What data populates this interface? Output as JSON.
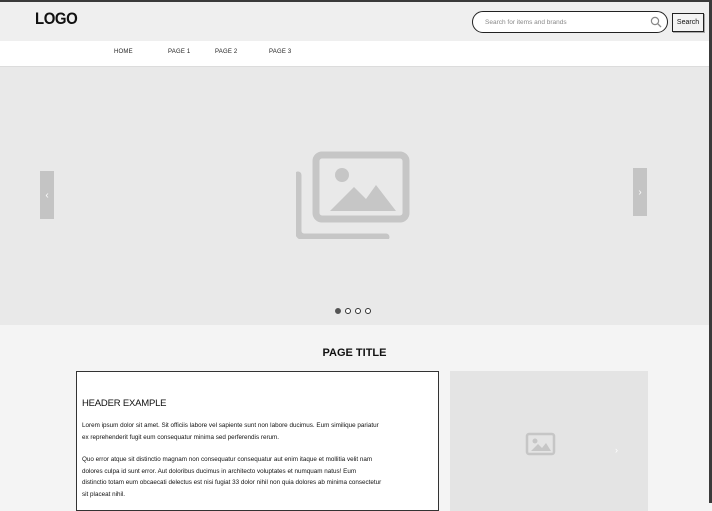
{
  "header": {
    "logo": "LOGO",
    "search_placeholder": "Search for items and brands",
    "search_button": "Search"
  },
  "nav": {
    "items": [
      "HOME",
      "PAGE 1",
      "PAGE 2",
      "PAGE 3"
    ]
  },
  "carousel": {
    "prev_arrow": "‹",
    "next_arrow": "›",
    "slide_count": 4,
    "active_slide": 1
  },
  "content": {
    "page_title": "PAGE TITLE",
    "card": {
      "header": "HEADER EXAMPLE",
      "paragraph1": "Lorem ipsum dolor sit amet. Sit officiis labore vel sapiente sunt non labore ducimus. Eum similique pariatur ex reprehenderit fugit eum consequatur minima sed perferendis rerum.",
      "paragraph2": "Quo error atque sit distinctio magnam non consequatur consequatur aut enim itaque et mollitia velit nam dolores culpa id sunt error. Aut doloribus ducimus in architecto voluptates et numquam natus! Eum distinctio totam eum obcaecati delectus est nisi fugiat 33 dolor nihil non quia dolores ab minima consectetur sit placeat nihil."
    },
    "side_arrow": "›"
  },
  "colors": {
    "frame": "#3a3a3a",
    "hero_bg": "#e9e9e9",
    "placeholder_icon": "#c6c6c6"
  }
}
